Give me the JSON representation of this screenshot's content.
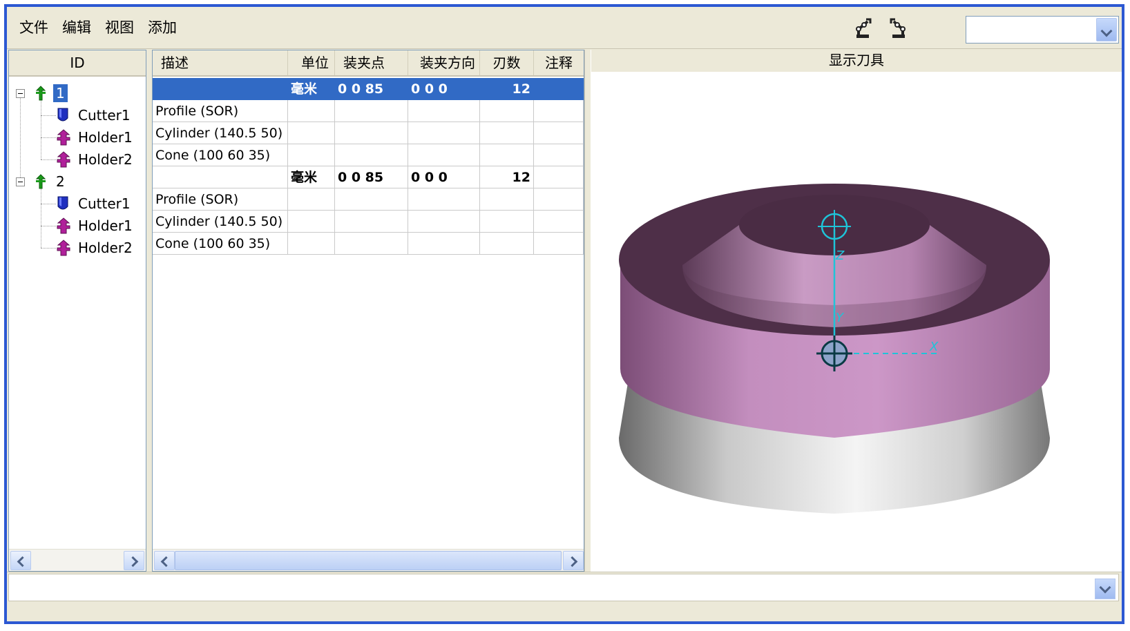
{
  "menu": {
    "file": "文件",
    "edit": "编辑",
    "view": "视图",
    "add": "添加"
  },
  "toolbar": {
    "icon1": "robot-arm-icon",
    "icon2": "robot-arm-alt-icon",
    "combo_value": ""
  },
  "tree": {
    "header": "ID",
    "nodes": [
      {
        "label": "1",
        "icon": "assembly-icon",
        "selected": true
      },
      {
        "label": "Cutter1",
        "icon": "cutter-icon"
      },
      {
        "label": "Holder1",
        "icon": "holder-icon"
      },
      {
        "label": "Holder2",
        "icon": "holder-icon"
      },
      {
        "label": "2",
        "icon": "assembly-icon"
      },
      {
        "label": "Cutter1",
        "icon": "cutter-icon"
      },
      {
        "label": "Holder1",
        "icon": "holder-icon"
      },
      {
        "label": "Holder2",
        "icon": "holder-icon"
      }
    ]
  },
  "table": {
    "columns": [
      "描述",
      "单位",
      "装夹点",
      "装夹方向",
      "刃数",
      "注释"
    ],
    "rows": [
      [
        "",
        "毫米",
        "0 0 85",
        "0 0 0",
        "12",
        ""
      ],
      [
        "Profile (SOR)",
        "",
        "",
        "",
        "",
        ""
      ],
      [
        "Cylinder (140.5 50)",
        "",
        "",
        "",
        "",
        ""
      ],
      [
        "Cone (100 60 35)",
        "",
        "",
        "",
        "",
        ""
      ],
      [
        "",
        "毫米",
        "0 0 85",
        "0 0 0",
        "12",
        ""
      ],
      [
        "Profile (SOR)",
        "",
        "",
        "",
        "",
        ""
      ],
      [
        "Cylinder (140.5 50)",
        "",
        "",
        "",
        "",
        ""
      ],
      [
        "Cone (100 60 35)",
        "",
        "",
        "",
        "",
        ""
      ]
    ]
  },
  "viewer": {
    "title": "显示刀具",
    "axis_labels": {
      "z": "Z",
      "y": "Y",
      "x": "X"
    }
  },
  "colors": {
    "selection": "#316ac5",
    "holder_top": "#4e2f48",
    "holder_side": "#c58ec0",
    "cutter": "#e6e6e6",
    "axis": "#1ec4d8"
  }
}
